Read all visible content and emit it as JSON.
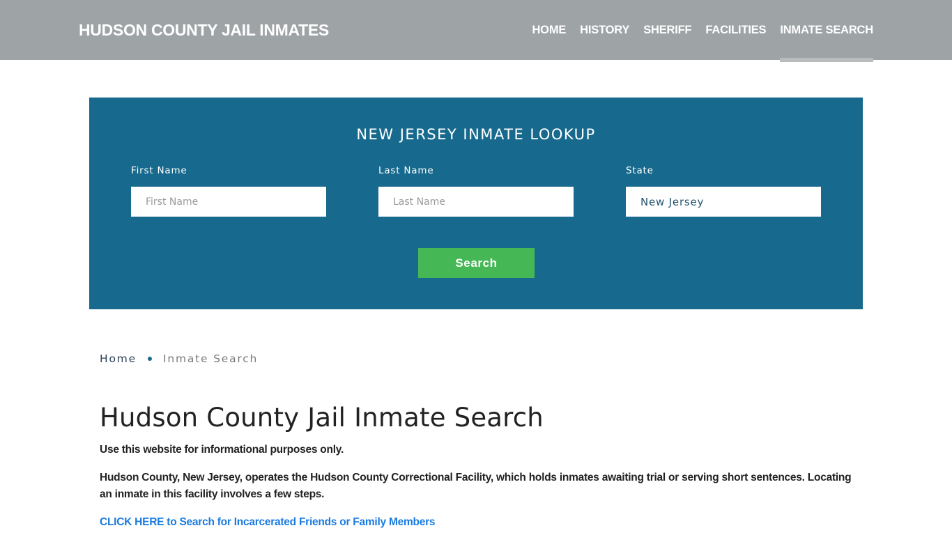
{
  "header": {
    "brand": "HUDSON COUNTY JAIL INMATES",
    "nav": [
      {
        "label": "HOME",
        "active": false
      },
      {
        "label": "HISTORY",
        "active": false
      },
      {
        "label": "SHERIFF",
        "active": false
      },
      {
        "label": "FACILITIES",
        "active": false
      },
      {
        "label": "INMATE SEARCH",
        "active": true
      }
    ]
  },
  "lookup": {
    "title": "NEW JERSEY INMATE LOOKUP",
    "first_name": {
      "label": "First Name",
      "placeholder": "First Name",
      "value": ""
    },
    "last_name": {
      "label": "Last Name",
      "placeholder": "Last Name",
      "value": ""
    },
    "state": {
      "label": "State",
      "value": "New Jersey"
    },
    "search_label": "Search"
  },
  "breadcrumb": {
    "home": "Home",
    "current": "Inmate Search"
  },
  "content": {
    "title": "Hudson County Jail Inmate Search",
    "disclaimer": "Use this website for informational purposes only.",
    "intro": "Hudson County, New Jersey, operates the Hudson County Correctional Facility, which holds inmates awaiting trial or serving short sentences. Locating an inmate in this facility involves a few steps.",
    "cta": "CLICK HERE to Search for Incarcerated Friends or Family Members"
  },
  "colors": {
    "header_bg": "#9ea3a6",
    "lookup_bg": "#176a8d",
    "search_button": "#45b855",
    "link": "#1a7be0"
  }
}
